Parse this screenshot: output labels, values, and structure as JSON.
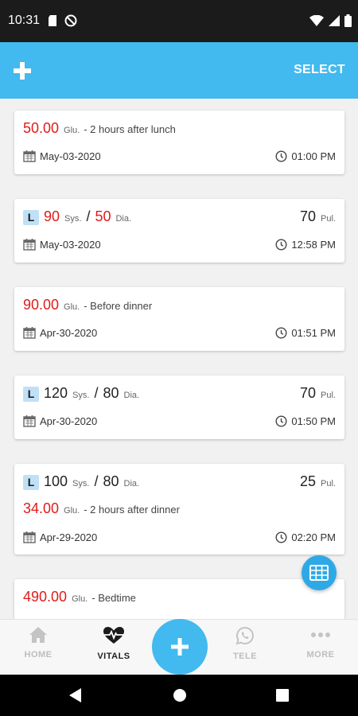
{
  "status_bar": {
    "time": "10:31"
  },
  "app_bar": {
    "select_label": "SELECT"
  },
  "entries": [
    {
      "type": "glucose",
      "value": "50.00",
      "unit": "Glu.",
      "note": "- 2 hours after lunch",
      "date": "May-03-2020",
      "time": "01:00 PM"
    },
    {
      "type": "bp",
      "badge": "L",
      "sys": "90",
      "sys_unit": "Sys.",
      "sep": "/",
      "dia": "50",
      "dia_unit": "Dia.",
      "pulse": "70",
      "pulse_unit": "Pul.",
      "date": "May-03-2020",
      "time": "12:58 PM"
    },
    {
      "type": "glucose",
      "value": "90.00",
      "unit": "Glu.",
      "note": "- Before dinner",
      "date": "Apr-30-2020",
      "time": "01:51 PM"
    },
    {
      "type": "bp",
      "badge": "L",
      "sys": "120",
      "sys_unit": "Sys.",
      "sep": "/",
      "dia": "80",
      "dia_unit": "Dia.",
      "pulse": "70",
      "pulse_unit": "Pul.",
      "date": "Apr-30-2020",
      "time": "01:50 PM"
    },
    {
      "type": "combined",
      "badge": "L",
      "sys": "100",
      "sys_unit": "Sys.",
      "sep": "/",
      "dia": "80",
      "dia_unit": "Dia.",
      "pulse": "25",
      "pulse_unit": "Pul.",
      "glucose": "34.00",
      "glucose_unit": "Glu.",
      "note": "- 2 hours after dinner",
      "date": "Apr-29-2020",
      "time": "02:20 PM"
    },
    {
      "type": "glucose",
      "value": "490.00",
      "unit": "Glu.",
      "note": "- Bedtime"
    }
  ],
  "bottom_nav": {
    "home": "HOME",
    "vitals": "VITALS",
    "tele": "TELE",
    "more": "MORE"
  },
  "colors": {
    "accent": "#42b9ef",
    "fab": "#2fa9e6",
    "reading_high": "#e01b1b",
    "badge_bg": "#bfe0f7"
  },
  "icons": {
    "status_left": [
      "sd-card-icon",
      "no-disturb-icon"
    ],
    "status_right": [
      "wifi-icon",
      "signal-icon",
      "battery-icon"
    ],
    "card": [
      "calendar-icon",
      "clock-icon"
    ],
    "nav": [
      "home-icon",
      "heartbeat-icon",
      "plus-icon",
      "whatsapp-icon",
      "dots-icon"
    ]
  }
}
